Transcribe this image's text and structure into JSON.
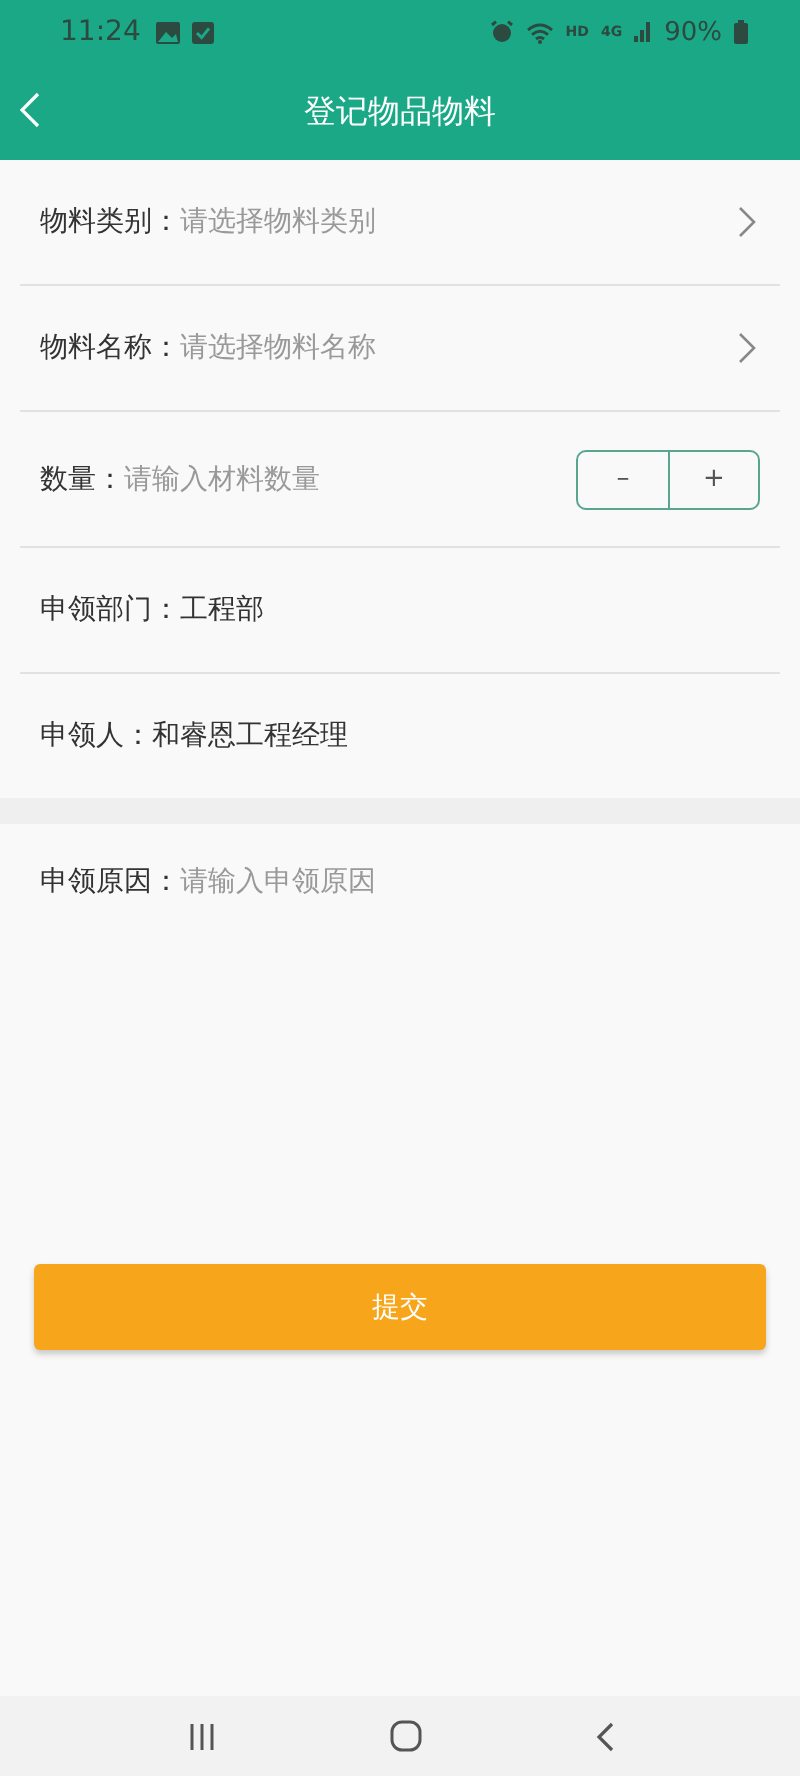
{
  "status_bar": {
    "time": "11:24",
    "network_hd": "HD",
    "network_gen": "4G",
    "battery": "90%"
  },
  "header": {
    "title": "登记物品物料"
  },
  "form_rows": [
    {
      "kind": "select",
      "label": "物料类别：",
      "placeholder": "请选择物料类别"
    },
    {
      "kind": "select",
      "label": "物料名称：",
      "placeholder": "请选择物料名称"
    },
    {
      "kind": "stepper",
      "label": "数量：",
      "placeholder": "请输入材料数量",
      "minus": "–",
      "plus": "+"
    },
    {
      "kind": "static",
      "label": "申领部门：",
      "value": "工程部"
    },
    {
      "kind": "static",
      "label": "申领人：",
      "value": "和睿恩工程经理"
    }
  ],
  "reason": {
    "label": "申领原因：",
    "placeholder": "请输入申领原因"
  },
  "submit": {
    "label": "提交"
  }
}
